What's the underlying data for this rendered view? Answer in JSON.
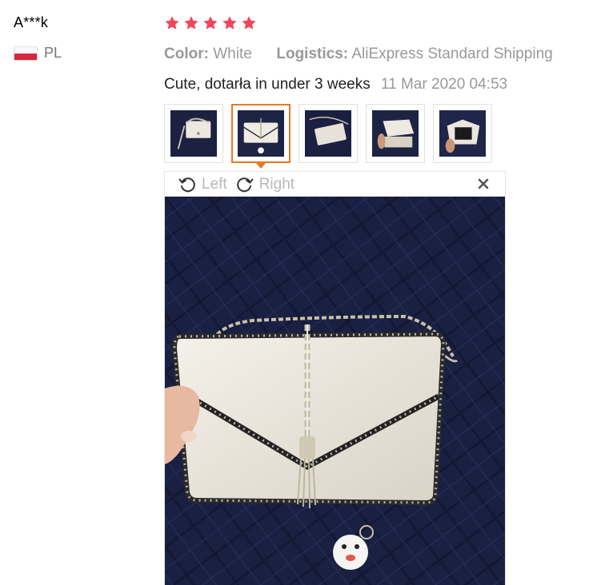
{
  "reviewer": {
    "name": "A***k",
    "country_code": "PL",
    "flag_colors": [
      "#f7f7f7",
      "#d7263d"
    ]
  },
  "review": {
    "rating": 5,
    "star_color": "#f0465a",
    "color_label": "Color:",
    "color_value": "White",
    "logistics_label": "Logistics:",
    "logistics_value": "AliExpress Standard Shipping",
    "text": "Cute, dotarła in under 3 weeks",
    "date": "11 Mar 2020 04:53"
  },
  "photos": {
    "count": 5,
    "selected_index": 1,
    "accent_color": "#e87722"
  },
  "viewer": {
    "rotate_left_label": "Left",
    "rotate_right_label": "Right",
    "close_icon": "close-icon"
  }
}
